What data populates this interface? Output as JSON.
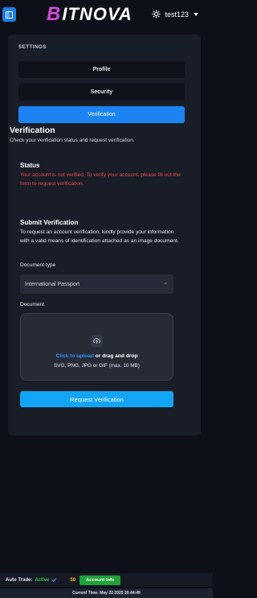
{
  "header": {
    "logo_initial": "B",
    "logo_rest": "ITNOVA",
    "username": "test123"
  },
  "settings": {
    "label": "SETTINGS",
    "tabs": [
      {
        "label": "Profile",
        "active": false
      },
      {
        "label": "Security",
        "active": false
      },
      {
        "label": "Verification",
        "active": true
      }
    ]
  },
  "verification": {
    "title": "Verification",
    "subtitle": "Check your verification status and request verification.",
    "status_title": "Status",
    "status_text": "Your account is not verified. To verify your account, please fill out the form to request verification.",
    "submit_title": "Submit Verification",
    "submit_text": "To request an account verification, kindly provide your information with a valid means of identification attached as an image document.",
    "document_type_label": "Document type",
    "document_type_value": "International Passport",
    "document_label": "Document",
    "upload_link": "Click to upload",
    "upload_rest": " or drag and drop",
    "upload_formats": "SVG, PNG, JPG or GIF (max. 10 MB)",
    "request_button": "Request Verification"
  },
  "footer": {
    "auto_trade_label": "Auto Trade:",
    "auto_trade_value": "Active",
    "balance": "$0",
    "account_info_button": "Account Info",
    "current_time": "Current Time: May 22 2025 20:44:49"
  },
  "colors": {
    "accent": "#1b84f2",
    "error": "#ec4a4a",
    "success": "#1fa23a",
    "balance": "#f0b323"
  }
}
